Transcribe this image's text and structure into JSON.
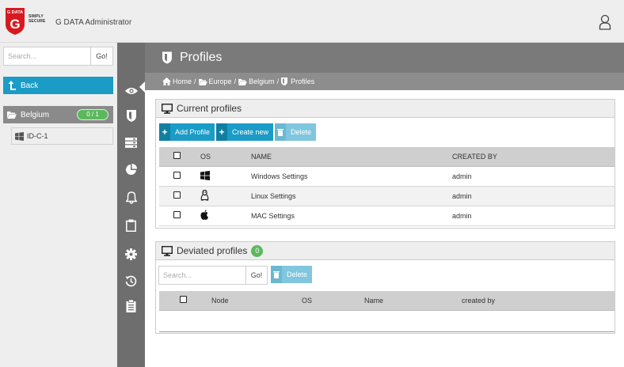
{
  "header": {
    "logo_text": "G DATA",
    "logo_tagline_1": "SIMPLY",
    "logo_tagline_2": "SECURE",
    "app_title": "G DATA Administrator"
  },
  "sidebar": {
    "search_placeholder": "Search...",
    "go_label": "Go!",
    "back_label": "Back",
    "group": {
      "label": "Belgium",
      "badge": "0 / 1"
    },
    "clients": [
      {
        "label": "ID-C-1"
      }
    ]
  },
  "rail": {
    "items": [
      "eye-icon",
      "shield-icon",
      "server-icon",
      "pie-chart-icon",
      "bell-icon",
      "clipboard-icon",
      "gear-icon",
      "history-icon",
      "report-icon"
    ],
    "active_index": 0
  },
  "page": {
    "title": "Profiles",
    "breadcrumb": [
      "Home",
      "Europe",
      "Belgium",
      "Profiles"
    ]
  },
  "current_profiles": {
    "title": "Current profiles",
    "add_label": "Add Profile",
    "create_label": "Create new",
    "delete_label": "Delete",
    "columns": [
      "OS",
      "NAME",
      "CREATED BY"
    ],
    "rows": [
      {
        "os": "windows-icon",
        "name": "Windows Settings",
        "created_by": "admin"
      },
      {
        "os": "linux-icon",
        "name": "Linux Settings",
        "created_by": "admin"
      },
      {
        "os": "apple-icon",
        "name": "MAC Settings",
        "created_by": "admin"
      }
    ]
  },
  "deviated_profiles": {
    "title": "Deviated profiles",
    "count": "0",
    "search_placeholder": "Search...",
    "go_label": "Go!",
    "delete_label": "Delete",
    "columns": [
      "Node",
      "OS",
      "Name",
      "created by"
    ]
  },
  "colors": {
    "accent": "#1a9cc6",
    "badge_green": "#5cb85c",
    "title_bar": "#7a7a7a",
    "rail": "#6e6e6e"
  }
}
